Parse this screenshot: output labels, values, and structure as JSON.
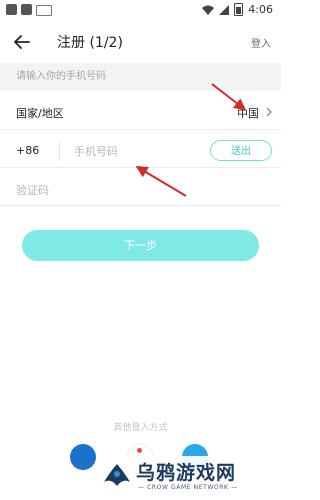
{
  "status_bar": {
    "time": "4:06"
  },
  "header": {
    "title": "注册 (1/2)",
    "login_link": "登入"
  },
  "hint": "请输入你的手机号码",
  "country": {
    "label": "国家/地区",
    "value": "中国"
  },
  "phone": {
    "dial_code": "+86",
    "placeholder": "手机号码",
    "send_code_label": "送出"
  },
  "code": {
    "placeholder": "验证码"
  },
  "next_button_label": "下一步",
  "other_login": {
    "title": "其他登入方式"
  },
  "watermark": {
    "main": "乌鸦游戏网",
    "sub": "— CROW GAME NETWORK —"
  },
  "colors": {
    "accent": "#7ee9e5",
    "accent_text": "#3fcfc9",
    "annotation_arrow": "#d42a2a"
  }
}
